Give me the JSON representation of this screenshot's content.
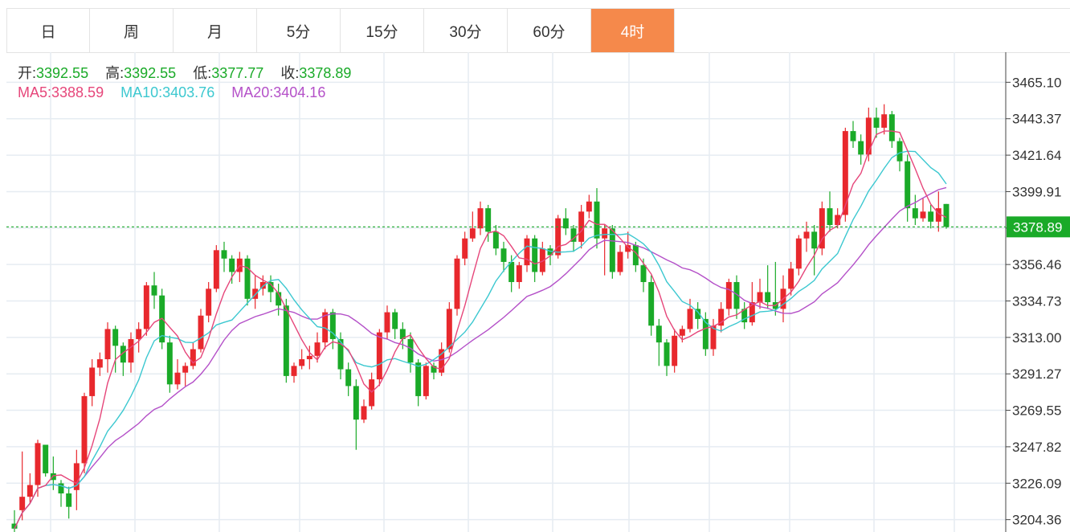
{
  "tabs": [
    {
      "label": "日",
      "active": false
    },
    {
      "label": "周",
      "active": false
    },
    {
      "label": "月",
      "active": false
    },
    {
      "label": "5分",
      "active": false
    },
    {
      "label": "15分",
      "active": false
    },
    {
      "label": "30分",
      "active": false
    },
    {
      "label": "60分",
      "active": false
    },
    {
      "label": "4时",
      "active": true
    }
  ],
  "colors": {
    "active_tab": "#f5894b",
    "up": "#e8282d",
    "down": "#1aaa28",
    "ma5": "#e6467a",
    "ma10": "#3cc8d0",
    "ma20": "#b450c8",
    "grid": "#e6ecf2",
    "current_price_bg": "#1aaa28"
  },
  "ohlc": {
    "open_label": "开:",
    "open": "3392.55",
    "high_label": "高:",
    "high": "3392.55",
    "low_label": "低:",
    "low": "3377.77",
    "close_label": "收:",
    "close": "3378.89"
  },
  "ma": {
    "ma5_label": "MA5:",
    "ma5": "3388.59",
    "ma10_label": "MA10:",
    "ma10": "3403.76",
    "ma20_label": "MA20:",
    "ma20": "3404.16"
  },
  "current_price_label": "3378.89",
  "chart_data": {
    "type": "candlestick",
    "yticks": [
      "3465.10",
      "3443.37",
      "3421.64",
      "3399.91",
      "3378.18",
      "3356.46",
      "3334.73",
      "3313.00",
      "3291.27",
      "3269.55",
      "3247.82",
      "3226.09",
      "3204.36"
    ],
    "ylim": [
      3200,
      3480
    ],
    "current_price": 3378.89,
    "candles": [
      [
        3202,
        3199,
        3210,
        3196
      ],
      [
        3210,
        3218,
        3245,
        3204
      ],
      [
        3218,
        3225,
        3232,
        3214
      ],
      [
        3225,
        3250,
        3252,
        3218
      ],
      [
        3249,
        3232,
        3248,
        3230
      ],
      [
        3232,
        3228,
        3242,
        3222
      ],
      [
        3226,
        3220,
        3228,
        3212
      ],
      [
        3220,
        3212,
        3224,
        3205
      ],
      [
        3222,
        3238,
        3246,
        3210
      ],
      [
        3238,
        3278,
        3280,
        3232
      ],
      [
        3278,
        3295,
        3300,
        3272
      ],
      [
        3295,
        3300,
        3304,
        3290
      ],
      [
        3300,
        3318,
        3322,
        3292
      ],
      [
        3318,
        3308,
        3320,
        3292
      ],
      [
        3308,
        3298,
        3310,
        3290
      ],
      [
        3298,
        3312,
        3316,
        3292
      ],
      [
        3312,
        3318,
        3322,
        3304
      ],
      [
        3318,
        3344,
        3346,
        3314
      ],
      [
        3344,
        3338,
        3352,
        3330
      ],
      [
        3338,
        3310,
        3342,
        3306
      ],
      [
        3310,
        3285,
        3314,
        3280
      ],
      [
        3285,
        3292,
        3300,
        3282
      ],
      [
        3292,
        3296,
        3298,
        3284
      ],
      [
        3296,
        3306,
        3310,
        3294
      ],
      [
        3306,
        3326,
        3330,
        3304
      ],
      [
        3326,
        3342,
        3346,
        3322
      ],
      [
        3342,
        3365,
        3368,
        3340
      ],
      [
        3365,
        3360,
        3370,
        3352
      ],
      [
        3360,
        3352,
        3362,
        3345
      ],
      [
        3352,
        3360,
        3364,
        3346
      ],
      [
        3360,
        3336,
        3362,
        3332
      ],
      [
        3336,
        3342,
        3350,
        3330
      ],
      [
        3342,
        3346,
        3350,
        3338
      ],
      [
        3346,
        3340,
        3350,
        3334
      ],
      [
        3340,
        3332,
        3345,
        3326
      ],
      [
        3332,
        3290,
        3336,
        3286
      ],
      [
        3290,
        3296,
        3298,
        3286
      ],
      [
        3296,
        3300,
        3306,
        3294
      ],
      [
        3300,
        3302,
        3308,
        3294
      ],
      [
        3302,
        3310,
        3316,
        3298
      ],
      [
        3310,
        3328,
        3330,
        3306
      ],
      [
        3328,
        3312,
        3330,
        3306
      ],
      [
        3312,
        3294,
        3316,
        3288
      ],
      [
        3294,
        3284,
        3298,
        3278
      ],
      [
        3284,
        3264,
        3288,
        3246
      ],
      [
        3264,
        3272,
        3276,
        3262
      ],
      [
        3272,
        3288,
        3292,
        3270
      ],
      [
        3288,
        3316,
        3318,
        3284
      ],
      [
        3316,
        3328,
        3332,
        3312
      ],
      [
        3328,
        3318,
        3330,
        3312
      ],
      [
        3318,
        3312,
        3322,
        3306
      ],
      [
        3312,
        3298,
        3316,
        3292
      ],
      [
        3298,
        3278,
        3300,
        3272
      ],
      [
        3278,
        3296,
        3298,
        3276
      ],
      [
        3296,
        3292,
        3298,
        3288
      ],
      [
        3292,
        3306,
        3310,
        3290
      ],
      [
        3306,
        3330,
        3334,
        3304
      ],
      [
        3330,
        3360,
        3362,
        3326
      ],
      [
        3360,
        3372,
        3376,
        3356
      ],
      [
        3372,
        3378,
        3388,
        3370
      ],
      [
        3378,
        3390,
        3394,
        3374
      ],
      [
        3390,
        3376,
        3392,
        3370
      ],
      [
        3376,
        3366,
        3380,
        3362
      ],
      [
        3366,
        3358,
        3370,
        3352
      ],
      [
        3358,
        3346,
        3362,
        3340
      ],
      [
        3346,
        3356,
        3358,
        3342
      ],
      [
        3356,
        3372,
        3374,
        3352
      ],
      [
        3372,
        3352,
        3374,
        3346
      ],
      [
        3352,
        3366,
        3370,
        3350
      ],
      [
        3366,
        3362,
        3368,
        3356
      ],
      [
        3362,
        3384,
        3386,
        3360
      ],
      [
        3384,
        3378,
        3390,
        3374
      ],
      [
        3378,
        3370,
        3380,
        3364
      ],
      [
        3370,
        3388,
        3392,
        3366
      ],
      [
        3388,
        3394,
        3398,
        3384
      ],
      [
        3394,
        3372,
        3402,
        3366
      ],
      [
        3372,
        3378,
        3380,
        3350
      ],
      [
        3378,
        3352,
        3380,
        3348
      ],
      [
        3352,
        3364,
        3368,
        3350
      ],
      [
        3364,
        3368,
        3376,
        3360
      ],
      [
        3368,
        3356,
        3370,
        3352
      ],
      [
        3356,
        3346,
        3360,
        3340
      ],
      [
        3346,
        3320,
        3350,
        3314
      ],
      [
        3320,
        3310,
        3324,
        3296
      ],
      [
        3310,
        3296,
        3312,
        3290
      ],
      [
        3296,
        3314,
        3318,
        3292
      ],
      [
        3314,
        3318,
        3320,
        3310
      ],
      [
        3318,
        3330,
        3336,
        3316
      ],
      [
        3330,
        3324,
        3334,
        3318
      ],
      [
        3324,
        3306,
        3328,
        3302
      ],
      [
        3306,
        3320,
        3324,
        3302
      ],
      [
        3320,
        3330,
        3334,
        3316
      ],
      [
        3330,
        3346,
        3348,
        3326
      ],
      [
        3346,
        3330,
        3350,
        3324
      ],
      [
        3330,
        3322,
        3334,
        3318
      ],
      [
        3322,
        3334,
        3346,
        3320
      ],
      [
        3334,
        3340,
        3348,
        3330
      ],
      [
        3340,
        3334,
        3356,
        3330
      ],
      [
        3334,
        3330,
        3358,
        3326
      ],
      [
        3330,
        3342,
        3350,
        3322
      ],
      [
        3342,
        3354,
        3358,
        3338
      ],
      [
        3354,
        3372,
        3374,
        3350
      ],
      [
        3372,
        3376,
        3382,
        3364
      ],
      [
        3376,
        3366,
        3380,
        3350
      ],
      [
        3366,
        3390,
        3394,
        3362
      ],
      [
        3390,
        3380,
        3400,
        3376
      ],
      [
        3380,
        3386,
        3390,
        3378
      ],
      [
        3386,
        3436,
        3438,
        3382
      ],
      [
        3436,
        3430,
        3442,
        3426
      ],
      [
        3430,
        3422,
        3434,
        3416
      ],
      [
        3422,
        3444,
        3450,
        3418
      ],
      [
        3444,
        3438,
        3450,
        3432
      ],
      [
        3438,
        3446,
        3452,
        3434
      ],
      [
        3446,
        3430,
        3448,
        3426
      ],
      [
        3430,
        3418,
        3432,
        3412
      ],
      [
        3418,
        3390,
        3422,
        3382
      ],
      [
        3390,
        3384,
        3398,
        3380
      ],
      [
        3384,
        3388,
        3396,
        3382
      ],
      [
        3388,
        3382,
        3392,
        3378
      ],
      [
        3382,
        3390,
        3400,
        3376
      ],
      [
        3392.55,
        3378.89,
        3392.55,
        3377.77
      ]
    ]
  }
}
